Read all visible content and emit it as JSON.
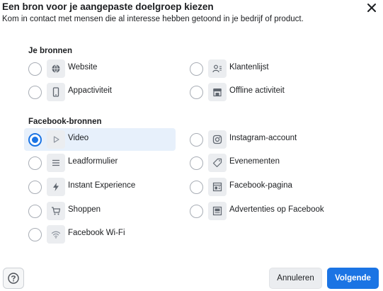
{
  "header": {
    "title": "Een bron voor je aangepaste doelgroep kiezen",
    "subtitle": "Kom in contact met mensen die al interesse hebben getoond in je bedrijf of product."
  },
  "sections": {
    "own": {
      "title": "Je bronnen",
      "options": [
        {
          "label": "Website",
          "icon": "globe-icon",
          "selected": false
        },
        {
          "label": "Klantenlijst",
          "icon": "customer-list-icon",
          "selected": false
        },
        {
          "label": "Appactiviteit",
          "icon": "phone-icon",
          "selected": false
        },
        {
          "label": "Offline activiteit",
          "icon": "store-icon",
          "selected": false
        }
      ]
    },
    "facebook": {
      "title": "Facebook-bronnen",
      "options": [
        {
          "label": "Video",
          "icon": "play-icon",
          "selected": true
        },
        {
          "label": "Instagram-account",
          "icon": "instagram-icon",
          "selected": false
        },
        {
          "label": "Leadformulier",
          "icon": "list-icon",
          "selected": false
        },
        {
          "label": "Evenementen",
          "icon": "ticket-icon",
          "selected": false
        },
        {
          "label": "Instant Experience",
          "icon": "lightning-icon",
          "selected": false
        },
        {
          "label": "Facebook-pagina",
          "icon": "page-icon",
          "selected": false
        },
        {
          "label": "Shoppen",
          "icon": "cart-icon",
          "selected": false
        },
        {
          "label": "Advertenties op Facebook",
          "icon": "ads-icon",
          "selected": false
        },
        {
          "label": "Facebook Wi-Fi",
          "icon": "wifi-icon",
          "selected": false
        }
      ]
    }
  },
  "footer": {
    "cancel_label": "Annuleren",
    "next_label": "Volgende"
  },
  "colors": {
    "accent": "#1b74e4",
    "selected_bg": "#e7f0fb",
    "icon_bg": "#ebedf0"
  }
}
